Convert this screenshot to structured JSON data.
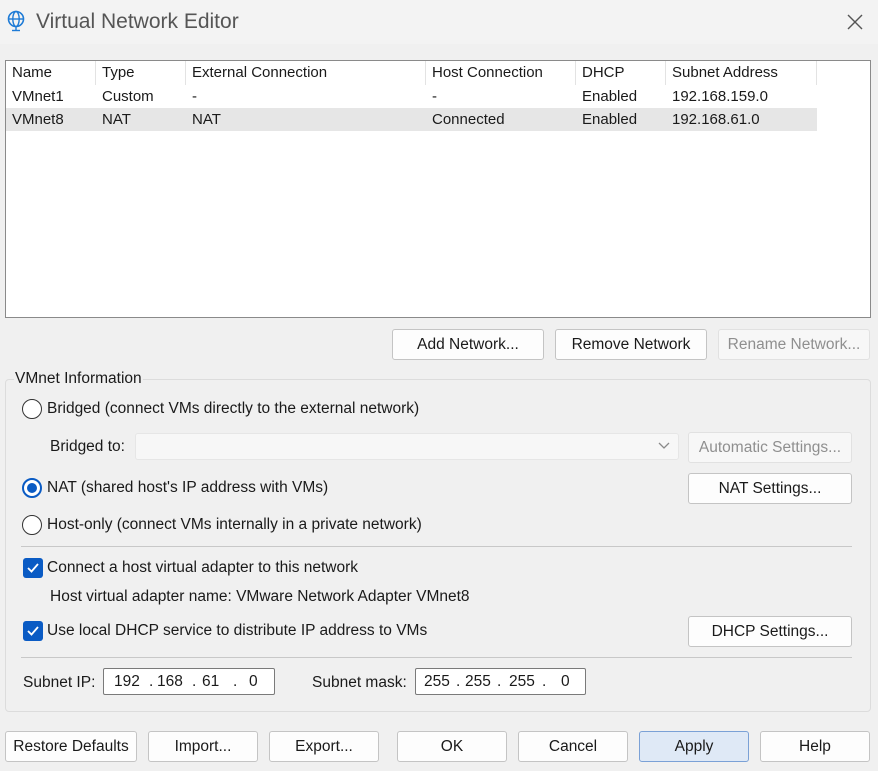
{
  "window": {
    "title": "Virtual Network Editor",
    "icon": "globe-icon",
    "close_icon": "close-icon"
  },
  "network_list": {
    "columns": [
      "Name",
      "Type",
      "External Connection",
      "Host Connection",
      "DHCP",
      "Subnet Address"
    ],
    "rows": [
      {
        "name": "VMnet1",
        "type": "Custom",
        "external": "-",
        "host": "-",
        "dhcp": "Enabled",
        "subnet": "192.168.159.0",
        "selected": false
      },
      {
        "name": "VMnet8",
        "type": "NAT",
        "external": "NAT",
        "host": "Connected",
        "dhcp": "Enabled",
        "subnet": "192.168.61.0",
        "selected": true
      }
    ]
  },
  "list_buttons": {
    "add": "Add Network...",
    "remove": "Remove Network",
    "rename": "Rename Network..."
  },
  "vmnet_info": {
    "group_label": "VMnet Information",
    "bridged_label": "Bridged (connect VMs directly to the external network)",
    "bridged_to_label": "Bridged to:",
    "bridged_to_value": "",
    "automatic_settings": "Automatic Settings...",
    "nat_label": "NAT (shared host's IP address with VMs)",
    "nat_settings": "NAT Settings...",
    "hostonly_label": "Host-only (connect VMs internally in a private network)",
    "selected_mode": "nat",
    "connect_adapter_label": "Connect a host virtual adapter to this network",
    "connect_adapter_checked": true,
    "adapter_name_text": "Host virtual adapter name: VMware Network Adapter VMnet8",
    "use_dhcp_label": "Use local DHCP service to distribute IP address to VMs",
    "use_dhcp_checked": true,
    "dhcp_settings": "DHCP Settings...",
    "subnet_ip_label": "Subnet IP:",
    "subnet_ip": [
      "192",
      "168",
      "61",
      "0"
    ],
    "subnet_mask_label": "Subnet mask:",
    "subnet_mask": [
      "255",
      "255",
      "255",
      "0"
    ],
    "ip_dot": "."
  },
  "footer_buttons": {
    "restore": "Restore Defaults",
    "import": "Import...",
    "export": "Export...",
    "ok": "OK",
    "cancel": "Cancel",
    "apply": "Apply",
    "help": "Help"
  },
  "colors": {
    "accent": "#0a5bc4",
    "apply_bg": "#dfe9f6",
    "selected_row": "#e6e6e6"
  }
}
